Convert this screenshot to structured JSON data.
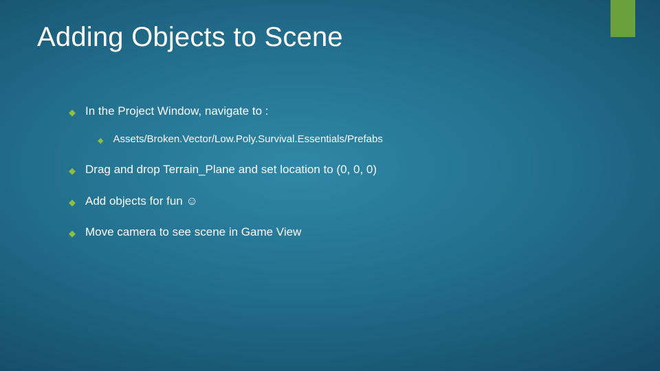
{
  "title": "Adding Objects to Scene",
  "bullets": {
    "b0": "In the Project Window, navigate to :",
    "b0_sub0": "Assets/Broken.Vector/Low.Poly.Survival.Essentials/Prefabs",
    "b1": "Drag and drop Terrain_Plane and set location to (0, 0, 0)",
    "b2": "Add objects for fun ☺",
    "b3": "Move camera to see scene in Game View"
  },
  "icons": {
    "diamond": "◆"
  },
  "colors": {
    "accent": "#6aa13e",
    "bullet": "#8fbf3f"
  }
}
